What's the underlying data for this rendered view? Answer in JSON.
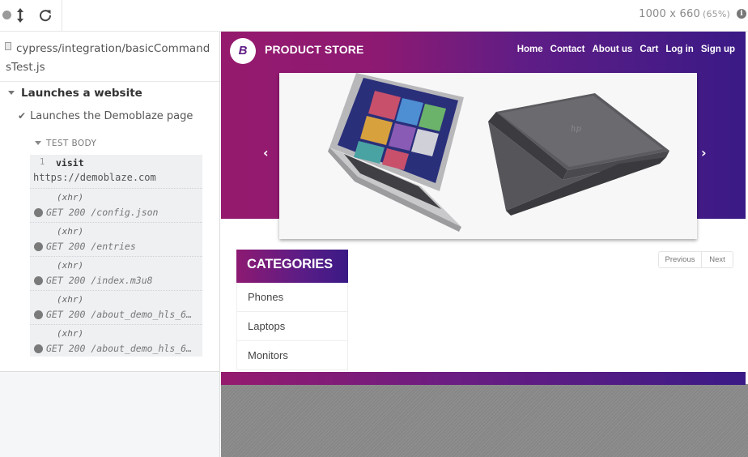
{
  "toolbar": {
    "viewport_size": "1000 x 660",
    "viewport_scale": "(65%)",
    "info_icon": "i"
  },
  "reporter": {
    "spec_path": "cypress/integration/basicCommandsTest.js",
    "suite_title": "Launches a website",
    "test_title": "Launches the Demoblaze page",
    "body_label": "TEST BODY",
    "commands": [
      {
        "num": "1",
        "name": "visit",
        "detail": "https://demoblaze.com"
      },
      {
        "type": "(xhr)",
        "message": "GET 200 /config.json"
      },
      {
        "type": "(xhr)",
        "message": "GET 200 /entries"
      },
      {
        "type": "(xhr)",
        "message": "GET 200 /index.m3u8"
      },
      {
        "type": "(xhr)",
        "message": "GET 200 /about_demo_hls_6…"
      },
      {
        "type": "(xhr)",
        "message": "GET 200 /about_demo_hls_6…"
      }
    ]
  },
  "app": {
    "logo_letter": "B",
    "brand": "PRODUCT STORE",
    "nav": [
      "Home",
      "Contact",
      "About us",
      "Cart",
      "Log in",
      "Sign up"
    ],
    "carousel_prev": "‹",
    "carousel_next": "›",
    "categories_title": "CATEGORIES",
    "categories": [
      "Phones",
      "Laptops",
      "Monitors"
    ],
    "pager_prev": "Previous",
    "pager_next": "Next"
  },
  "colors": {
    "brand_magenta": "#951a6e",
    "brand_purple": "#3a1a86"
  }
}
